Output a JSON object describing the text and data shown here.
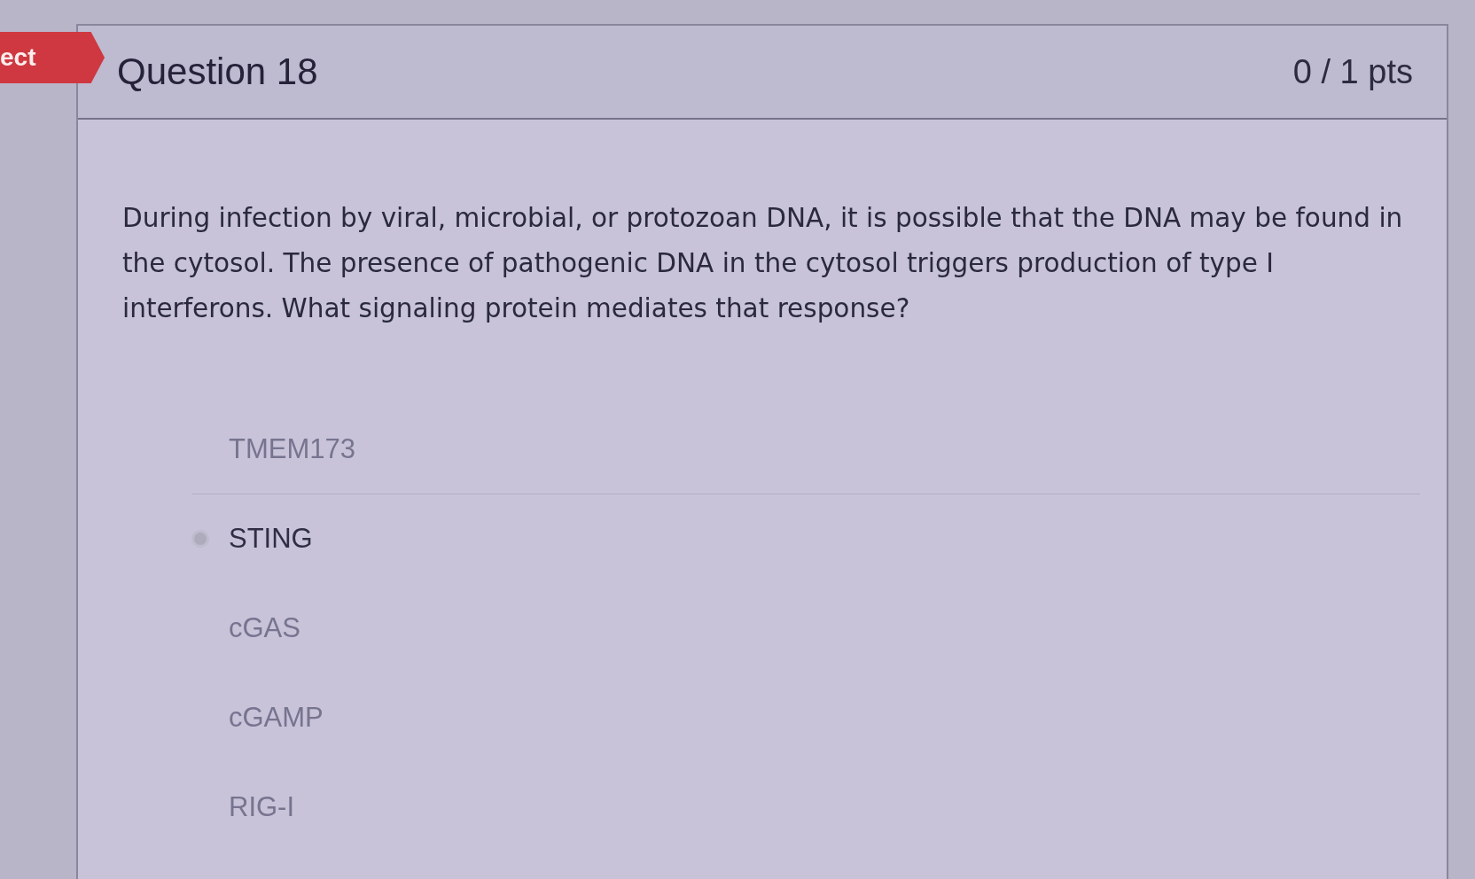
{
  "result_flag": {
    "label": "ect"
  },
  "question": {
    "title": "Question 18",
    "points": "0 / 1 pts",
    "text": "During infection by viral, microbial, or protozoan DNA, it is possible that the DNA may be found in the cytosol. The presence of pathogenic DNA in the cytosol triggers production of type I interferons. What signaling protein mediates that response?"
  },
  "answers": [
    {
      "label": "TMEM173",
      "selected": false
    },
    {
      "label": "STING",
      "selected": true
    },
    {
      "label": "cGAS",
      "selected": false
    },
    {
      "label": "cGAMP",
      "selected": false
    },
    {
      "label": "RIG-I",
      "selected": false
    }
  ]
}
